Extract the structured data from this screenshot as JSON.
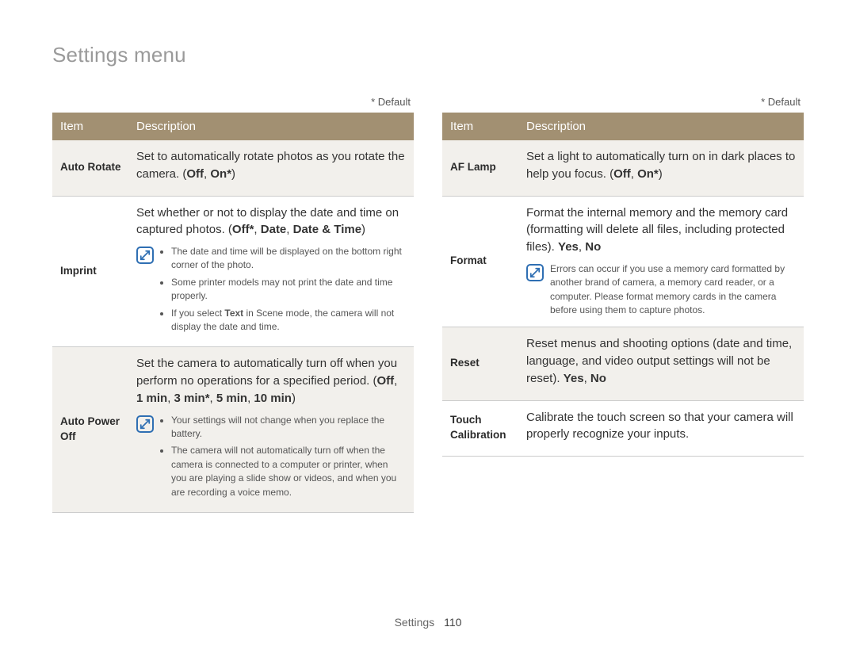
{
  "title": "Settings menu",
  "default_label": "* Default",
  "headers": {
    "item": "Item",
    "description": "Description"
  },
  "left": {
    "rows": [
      {
        "shade": true,
        "item": "Auto Rotate",
        "desc_plain": "Set to automatically rotate photos as you rotate the camera. ",
        "options": [
          "Off",
          "On*"
        ]
      },
      {
        "shade": false,
        "item": "Imprint",
        "desc_plain": "Set whether or not to display the date and time on captured photos. ",
        "options": [
          "Off*",
          "Date",
          "Date & Time"
        ],
        "notes": [
          "The date and time will be displayed on the bottom right corner of the photo.",
          "Some printer models may not print the date and time properly.",
          {
            "pre": "If you select ",
            "bold": "Text",
            "post": " in Scene mode, the camera will not display the date and time."
          }
        ]
      },
      {
        "shade": true,
        "item": "Auto Power Off",
        "desc_plain": "Set the camera to automatically turn off when you perform no operations for a specified period. ",
        "options": [
          "Off",
          "1 min",
          "3 min*",
          "5 min",
          "10 min"
        ],
        "notes": [
          "Your settings will not change when you replace the battery.",
          "The camera will not automatically turn off when the camera is connected to a computer or printer, when you are playing a slide show or videos, and when you are recording a voice memo."
        ]
      }
    ]
  },
  "right": {
    "rows": [
      {
        "shade": true,
        "item": "AF Lamp",
        "desc_plain": "Set a light to automatically turn on in dark places to help you focus. ",
        "options": [
          "Off",
          "On*"
        ]
      },
      {
        "shade": false,
        "item": "Format",
        "desc_plain": "Format the internal memory and the memory card (formatting will delete all files, including protected files). ",
        "options": [
          "Yes",
          "No"
        ],
        "note_single": "Errors can occur if you use a memory card formatted by another brand of camera, a memory card reader, or a computer. Please format memory cards in the camera before using them to capture photos."
      },
      {
        "shade": true,
        "item": "Reset",
        "desc_plain": "Reset menus and shooting options (date and time, language, and video output settings will not be reset). ",
        "options": [
          "Yes",
          "No"
        ]
      },
      {
        "shade": false,
        "item": "Touch Calibration",
        "desc_plain": "Calibrate the touch screen so that your camera will properly recognize your inputs."
      }
    ]
  },
  "footer": {
    "section": "Settings",
    "page": "110"
  }
}
